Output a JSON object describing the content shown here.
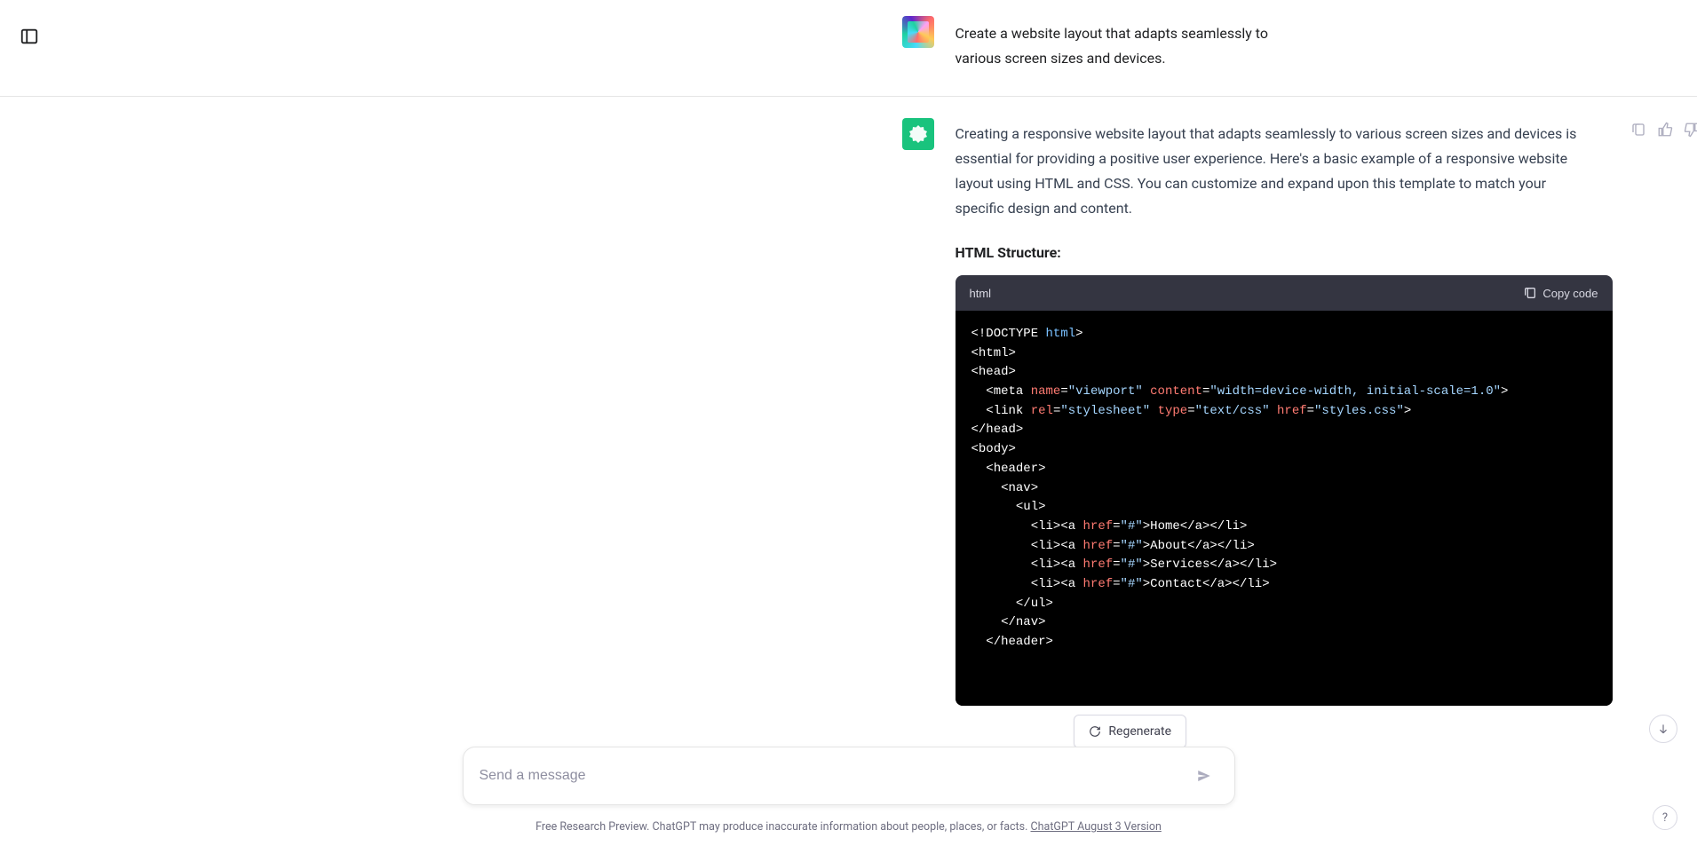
{
  "sidebar_toggle_name": "sidebar-toggle-icon",
  "user": {
    "message": "Create a website layout that adapts seamlessly to various screen sizes and devices."
  },
  "assistant": {
    "intro": "Creating a responsive website layout that adapts seamlessly to various screen sizes and devices is essential for providing a positive user experience. Here's a basic example of a responsive website layout using HTML and CSS. You can customize and expand upon this template to match your specific design and content.",
    "heading": "HTML Structure:",
    "code_language": "html",
    "copy_label": "Copy code",
    "code_lines": [
      [
        [
          "tag",
          "<!DOCTYPE "
        ],
        [
          "kw",
          "html"
        ],
        [
          "tag",
          ">"
        ]
      ],
      [
        [
          "tag",
          "<html>"
        ]
      ],
      [
        [
          "tag",
          "<head>"
        ]
      ],
      [
        [
          "tag",
          "  <meta "
        ],
        [
          "attr",
          "name"
        ],
        [
          "tag",
          "="
        ],
        [
          "str",
          "\"viewport\""
        ],
        [
          "tag",
          " "
        ],
        [
          "attr",
          "content"
        ],
        [
          "tag",
          "="
        ],
        [
          "str",
          "\"width=device-width, initial-scale=1.0\""
        ],
        [
          "tag",
          ">"
        ]
      ],
      [
        [
          "tag",
          "  <link "
        ],
        [
          "attr",
          "rel"
        ],
        [
          "tag",
          "="
        ],
        [
          "str",
          "\"stylesheet\""
        ],
        [
          "tag",
          " "
        ],
        [
          "attr",
          "type"
        ],
        [
          "tag",
          "="
        ],
        [
          "str",
          "\"text/css\""
        ],
        [
          "tag",
          " "
        ],
        [
          "attr",
          "href"
        ],
        [
          "tag",
          "="
        ],
        [
          "str",
          "\"styles.css\""
        ],
        [
          "tag",
          ">"
        ]
      ],
      [
        [
          "tag",
          "</head>"
        ]
      ],
      [
        [
          "tag",
          "<body>"
        ]
      ],
      [
        [
          "tag",
          "  <header>"
        ]
      ],
      [
        [
          "tag",
          "    <nav>"
        ]
      ],
      [
        [
          "tag",
          "      <ul>"
        ]
      ],
      [
        [
          "tag",
          "        <li><a "
        ],
        [
          "attr",
          "href"
        ],
        [
          "tag",
          "="
        ],
        [
          "str",
          "\"#\""
        ],
        [
          "tag",
          ">Home</a></li>"
        ]
      ],
      [
        [
          "tag",
          "        <li><a "
        ],
        [
          "attr",
          "href"
        ],
        [
          "tag",
          "="
        ],
        [
          "str",
          "\"#\""
        ],
        [
          "tag",
          ">About</a></li>"
        ]
      ],
      [
        [
          "tag",
          "        <li><a "
        ],
        [
          "attr",
          "href"
        ],
        [
          "tag",
          "="
        ],
        [
          "str",
          "\"#\""
        ],
        [
          "tag",
          ">Services</a></li>"
        ]
      ],
      [
        [
          "tag",
          "        <li><a "
        ],
        [
          "attr",
          "href"
        ],
        [
          "tag",
          "="
        ],
        [
          "str",
          "\"#\""
        ],
        [
          "tag",
          ">Contact</a></li>"
        ]
      ],
      [
        [
          "tag",
          "      </ul>"
        ]
      ],
      [
        [
          "tag",
          "    </nav>"
        ]
      ],
      [
        [
          "tag",
          "  </header>"
        ]
      ]
    ]
  },
  "regenerate_label": "Regenerate",
  "input_placeholder": "Send a message",
  "footer": {
    "text": "Free Research Preview. ChatGPT may produce inaccurate information about people, places, or facts. ",
    "link": "ChatGPT August 3 Version"
  },
  "help_label": "?"
}
